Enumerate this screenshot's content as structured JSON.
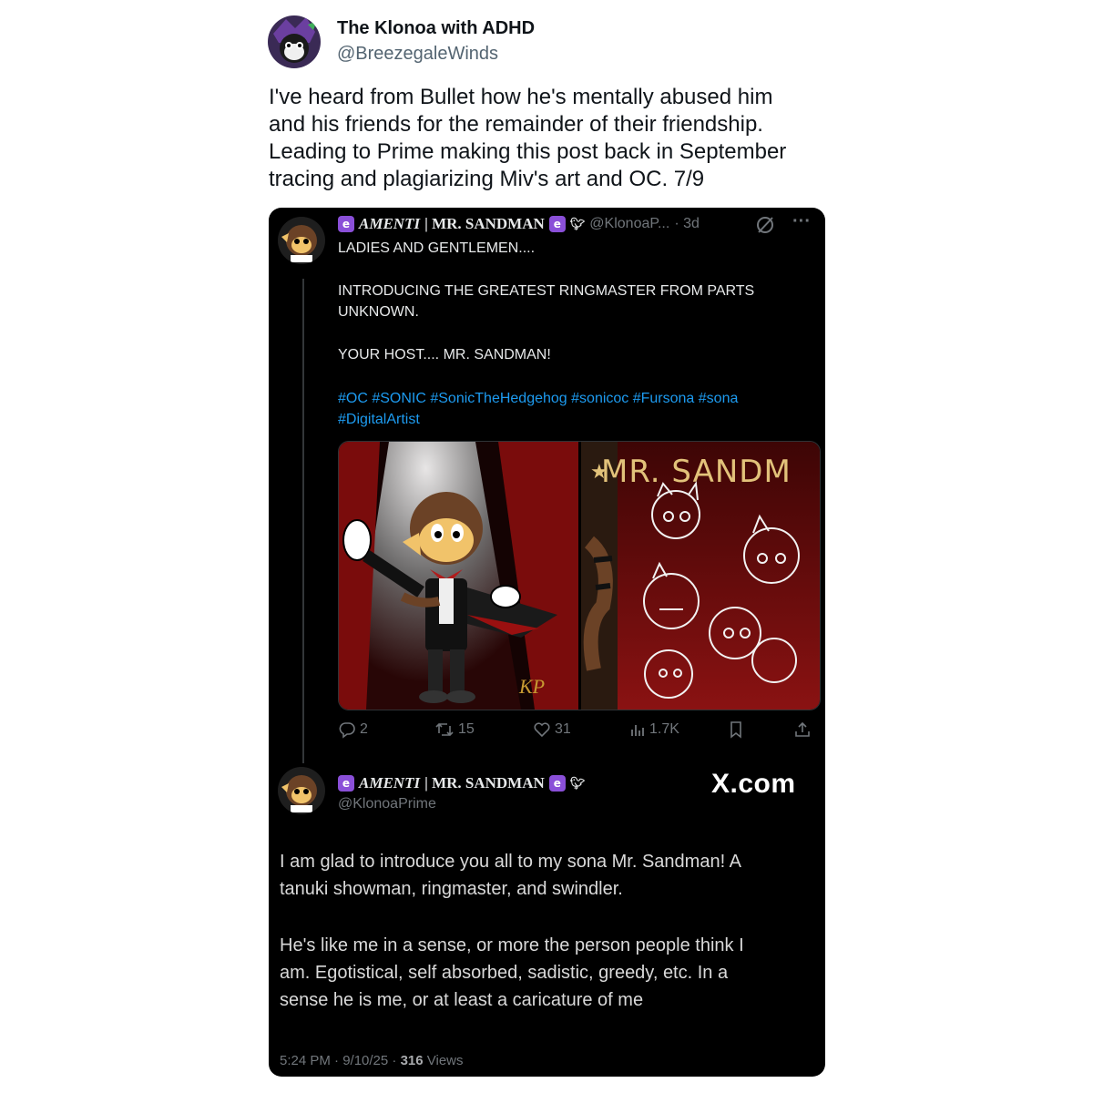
{
  "tweet": {
    "author_name": "The Klonoa with ADHD",
    "author_handle": "@BreezegaleWinds",
    "text_lines": [
      "I've heard from Bullet how he's mentally abused him",
      "and his friends for the remainder of their friendship.",
      "Leading to Prime making this post back in September",
      "tracing and plagiarizing Miv's art and OC. 7/9"
    ]
  },
  "embed": {
    "post1": {
      "name_prefix": "AMENTI",
      "name_suffix": "| MR. SANDMAN",
      "handle": "@KlonoaP...",
      "time": "· 3d",
      "lines": [
        "LADIES AND GENTLEMEN....",
        "INTRODUCING THE GREATEST RINGMASTER FROM PARTS",
        "UNKNOWN.",
        "YOUR HOST.... MR. SANDMAN!"
      ],
      "hashtags_line1": "#OC #SONIC #SonicTheHedgehog #sonicoc #Fursona #sona",
      "hashtags_line2": "#DigitalArtist",
      "media_title": "MR. SANDM",
      "signature": "KP",
      "stats": {
        "replies": "2",
        "reposts": "15",
        "likes": "31",
        "views": "1.7K"
      }
    },
    "post2": {
      "name_prefix": "AMENTI",
      "name_suffix": "| MR. SANDMAN",
      "handle": "@KlonoaPrime",
      "watermark": "X.com",
      "paragraph1": [
        "I am glad to introduce you all to my sona Mr. Sandman! A",
        "tanuki showman, ringmaster, and swindler."
      ],
      "paragraph2": [
        "He's like me in a sense, or more the person people think I",
        "am. Egotistical, self absorbed, sadistic, greedy, etc. In a",
        "sense he is me, or at least a caricature of me"
      ],
      "timestamp": "5:24 PM · 9/10/25 · ",
      "views_count": "316",
      "views_label": " Views"
    }
  },
  "colors": {
    "link": "#1d9bf0",
    "badge": "#8a4fd8",
    "dark_bg": "#000000"
  },
  "icons": [
    "reply-icon",
    "repost-icon",
    "like-icon",
    "views-icon",
    "bookmark-icon",
    "share-icon",
    "grok-icon",
    "more-icon",
    "verified-badge-icon",
    "bird-icon"
  ]
}
